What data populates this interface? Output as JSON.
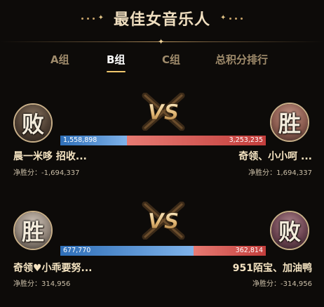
{
  "header": {
    "title": "最佳女音乐人"
  },
  "tabs": [
    {
      "label": "A组"
    },
    {
      "label": "B组"
    },
    {
      "label": "C组"
    },
    {
      "label": "总积分排行"
    }
  ],
  "active_tab": "B组",
  "vs_label": "VS",
  "net_label": "净胜分：",
  "matches": [
    {
      "left": {
        "result": "败",
        "name": "晨一米哆 招收...",
        "score": "1,558,898",
        "net": "-1,694,337"
      },
      "right": {
        "result": "胜",
        "name": "奇领、小小呵 ...",
        "score": "3,253,235",
        "net": "1,694,337"
      },
      "left_share": 0.324
    },
    {
      "left": {
        "result": "胜",
        "name": "奇领♥小乖要努...",
        "score": "677,770",
        "net": "314,956"
      },
      "right": {
        "result": "败",
        "name": "951陌宝、加油鸭",
        "score": "362,814",
        "net": "-314,956"
      },
      "left_share": 0.651
    }
  ],
  "colors": {
    "background": "#0d0b09",
    "accent_gold": "#f0c86e",
    "bar_blue": "#4a8ad6",
    "bar_red": "#d9574f"
  }
}
